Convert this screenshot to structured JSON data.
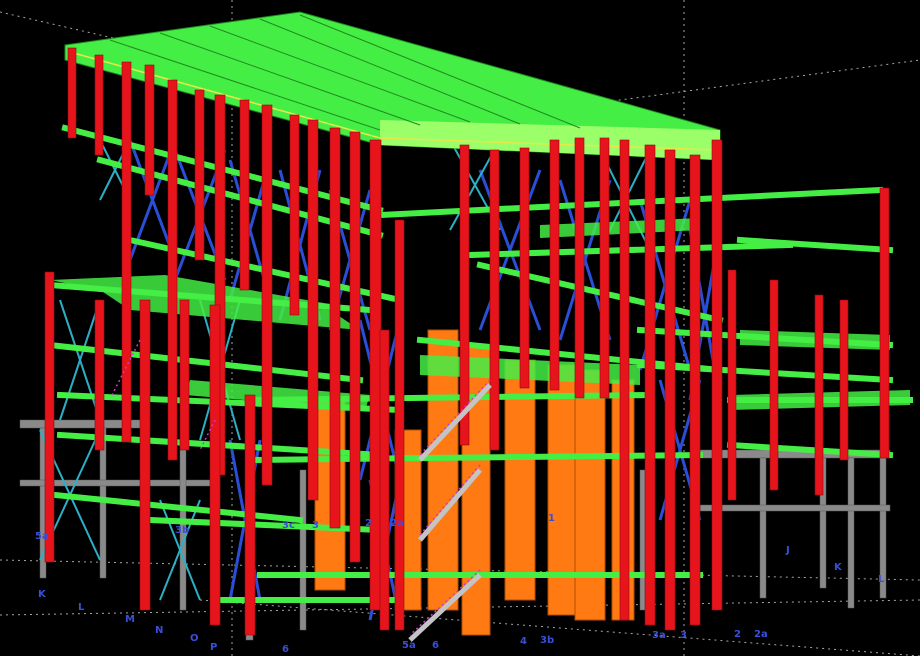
{
  "colors": {
    "background": "#000000",
    "beam": "#44ee44",
    "beam_light": "#9bff6a",
    "column": "#e8141c",
    "bracing": "#2a4fd6",
    "bracing_light": "#2bb0c8",
    "steel_gray": "#8a8a8a",
    "tank": "#ff7a12",
    "stair": "#c83cc8",
    "guide_lines": "#cfcfcf",
    "grid_label": "#3a4fd8"
  },
  "grid_labels": {
    "l_5a": "5a",
    "l_k": "K",
    "l_l": "L",
    "l_m": "M",
    "l_n": "N",
    "l_o": "O",
    "l_p": "P",
    "l_6": "6",
    "l_3b": "3b",
    "l_3c": "3c",
    "l_3": "3",
    "l_2": "2",
    "l_2a": "2a",
    "l_5a_b": "5a",
    "l_6b": "6",
    "l_4": "4",
    "l_3b_b": "3b",
    "l_1": "1",
    "l_3a": "3a",
    "l_3_b": "3",
    "l_2_b": "2",
    "l_2a_b": "2a",
    "l_j": "J",
    "l_k_b": "K",
    "l_l_b": "L"
  }
}
